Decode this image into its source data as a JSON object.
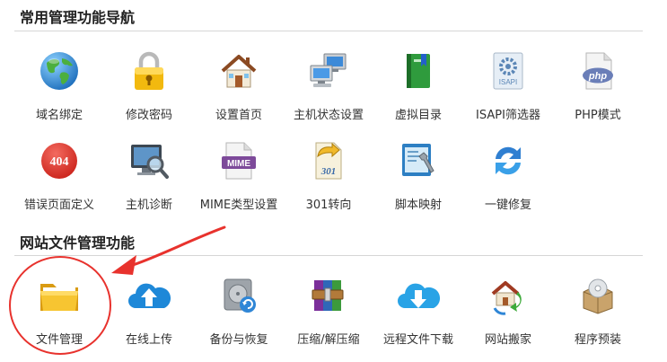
{
  "sections": [
    {
      "title": "常用管理功能导航",
      "rows": [
        [
          {
            "label": "域名绑定",
            "icon": "globe-icon"
          },
          {
            "label": "修改密码",
            "icon": "padlock-icon"
          },
          {
            "label": "设置首页",
            "icon": "house-icon"
          },
          {
            "label": "主机状态设置",
            "icon": "computers-icon"
          },
          {
            "label": "虚拟目录",
            "icon": "green-book-icon"
          },
          {
            "label": "ISAPI筛选器",
            "icon": "isapi-gear-icon"
          },
          {
            "label": "PHP模式",
            "icon": "php-file-icon"
          }
        ],
        [
          {
            "label": "错误页面定义",
            "icon": "error-404-icon"
          },
          {
            "label": "主机诊断",
            "icon": "monitor-magnifier-icon"
          },
          {
            "label": "MIME类型设置",
            "icon": "mime-document-icon"
          },
          {
            "label": "301转向",
            "icon": "redirect-301-icon"
          },
          {
            "label": "脚本映射",
            "icon": "script-wrench-icon"
          },
          {
            "label": "一键修复",
            "icon": "refresh-arrows-icon"
          }
        ]
      ]
    },
    {
      "title": "网站文件管理功能",
      "rows": [
        [
          {
            "label": "文件管理",
            "icon": "folder-icon"
          },
          {
            "label": "在线上传",
            "icon": "cloud-upload-icon"
          },
          {
            "label": "备份与恢复",
            "icon": "disk-backup-icon"
          },
          {
            "label": "压缩/解压缩",
            "icon": "archive-books-icon"
          },
          {
            "label": "远程文件下载",
            "icon": "cloud-download-icon"
          },
          {
            "label": "网站搬家",
            "icon": "house-move-icon"
          },
          {
            "label": "程序预装",
            "icon": "box-disc-icon"
          }
        ]
      ]
    }
  ],
  "colors": {
    "annotation": "#e8322d",
    "divider": "#d6d6d6"
  }
}
